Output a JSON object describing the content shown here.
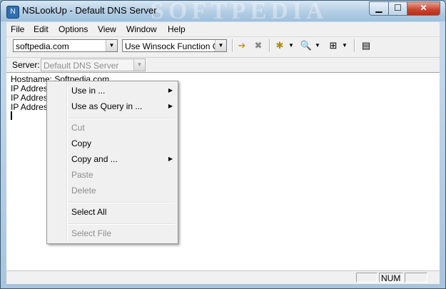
{
  "window": {
    "title": "NSLookUp - Default DNS Server",
    "watermark": "SOFTPEDIA",
    "app_icon_glyph": "N",
    "min_glyph": "▁",
    "max_glyph": "☐",
    "close_glyph": "✕"
  },
  "menubar": {
    "file": "File",
    "edit": "Edit",
    "options": "Options",
    "view": "View",
    "window": "Window",
    "help": "Help"
  },
  "toolbar": {
    "query_value": "softpedia.com",
    "method_value": "Use Winsock Function Ge",
    "dropdown_glyph": "▼",
    "icons": {
      "go": "➔",
      "stop": "✖",
      "add": "✱",
      "view": "🔍",
      "network": "⊞",
      "properties": "▤"
    }
  },
  "server": {
    "label": "Server:",
    "value": "Default DNS Server"
  },
  "output": {
    "lines": [
      "Hostname: Softpedia.com",
      "IP Address",
      "IP Address",
      "IP Address"
    ]
  },
  "context_menu": {
    "submenu_glyph": "▶",
    "items": [
      {
        "label": "Use in ...",
        "enabled": true,
        "submenu": true
      },
      {
        "label": "Use as Query in ...",
        "enabled": true,
        "submenu": true
      },
      {
        "label": "Cut",
        "enabled": false
      },
      {
        "label": "Copy",
        "enabled": true
      },
      {
        "label": "Copy and ...",
        "enabled": true,
        "submenu": true
      },
      {
        "label": "Paste",
        "enabled": false
      },
      {
        "label": "Delete",
        "enabled": false
      },
      {
        "label": "Select All",
        "enabled": true
      },
      {
        "label": "Select File",
        "enabled": false
      }
    ]
  },
  "statusbar": {
    "num": "NUM"
  },
  "colors": {
    "accent": "#2f6fb3",
    "close_button": "#c7432a",
    "disabled_text": "#8d8d8d"
  }
}
